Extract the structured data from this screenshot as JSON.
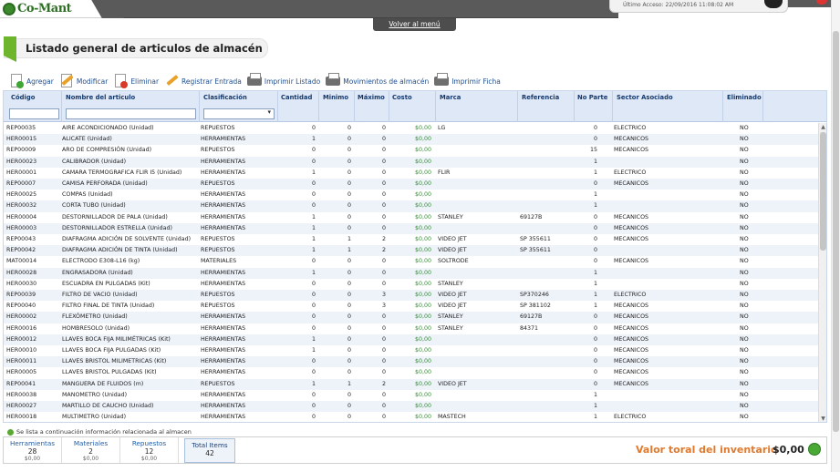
{
  "header": {
    "logo_text": "Co-Mant",
    "last_access": "Último Acceso: 22/09/2016 11:08:02 AM",
    "back_link": "Volver al menú"
  },
  "page": {
    "title": "Listado general de articulos de almacén"
  },
  "toolbar": {
    "add": "Agregar",
    "edit": "Modificar",
    "delete": "Eliminar",
    "register_entry": "Registrar Entrada",
    "print_list": "Imprimir Listado",
    "movements": "Movimientos de almacén",
    "print_sheet": "Imprimir Ficha"
  },
  "grid": {
    "columns": [
      "Código",
      "Nombre del articulo",
      "Clasificación",
      "Cantidad",
      "Minimo",
      "Máximo",
      "Costo",
      "Marca",
      "Referencia",
      "No Parte",
      "Sector Asociado",
      "Eliminado"
    ],
    "rows": [
      [
        "REP00035",
        "AIRE ACONDICIONADO (Unidad)",
        "REPUESTOS",
        "0",
        "0",
        "0",
        "$0,00",
        "LG",
        "",
        "0",
        "ELECTRICO",
        "NO"
      ],
      [
        "HER00015",
        "ALICATE (Unidad)",
        "HERRAMIENTAS",
        "1",
        "0",
        "0",
        "$0,00",
        "",
        "",
        "0",
        "MECANICOS",
        "NO"
      ],
      [
        "REP00009",
        "ARO DE COMPRESIÓN (Unidad)",
        "REPUESTOS",
        "0",
        "0",
        "0",
        "$0,00",
        "",
        "",
        "15",
        "MECANICOS",
        "NO"
      ],
      [
        "HER00023",
        "CALIBRADOR (Unidad)",
        "HERRAMIENTAS",
        "0",
        "0",
        "0",
        "$0,00",
        "",
        "",
        "1",
        "",
        "NO"
      ],
      [
        "HER00001",
        "CAMARA TERMOGRAFICA FLIR I5 (Unidad)",
        "HERRAMIENTAS",
        "1",
        "0",
        "0",
        "$0,00",
        "FLIR",
        "",
        "1",
        "ELECTRICO",
        "NO"
      ],
      [
        "REP00007",
        "CAMISA PERFORADA (Unidad)",
        "REPUESTOS",
        "0",
        "0",
        "0",
        "$0,00",
        "",
        "",
        "0",
        "MECANICOS",
        "NO"
      ],
      [
        "HER00025",
        "COMPAS (Unidad)",
        "HERRAMIENTAS",
        "0",
        "0",
        "0",
        "$0,00",
        "",
        "",
        "1",
        "",
        "NO"
      ],
      [
        "HER00032",
        "CORTA TUBO (Unidad)",
        "HERRAMIENTAS",
        "0",
        "0",
        "0",
        "$0,00",
        "",
        "",
        "1",
        "",
        "NO"
      ],
      [
        "HER00004",
        "DESTORNILLADOR DE PALA (Unidad)",
        "HERRAMIENTAS",
        "1",
        "0",
        "0",
        "$0,00",
        "STANLEY",
        "69127B",
        "0",
        "MECANICOS",
        "NO"
      ],
      [
        "HER00003",
        "DESTORNILLADOR ESTRELLA (Unidad)",
        "HERRAMIENTAS",
        "1",
        "0",
        "0",
        "$0,00",
        "",
        "",
        "0",
        "MECANICOS",
        "NO"
      ],
      [
        "REP00043",
        "DIAFRAGMA ADICIÓN DE SOLVENTE (Unidad)",
        "REPUESTOS",
        "1",
        "1",
        "2",
        "$0,00",
        "VIDEO JET",
        "SP 355611",
        "0",
        "MECANICOS",
        "NO"
      ],
      [
        "REP00042",
        "DIAFRAGMA ADICIÓN DE TINTA (Unidad)",
        "REPUESTOS",
        "1",
        "1",
        "2",
        "$0,00",
        "VIDEO JET",
        "SP 355611",
        "0",
        "",
        "NO"
      ],
      [
        "MAT00014",
        "ELECTRODO E308-L16 (kg)",
        "MATERIALES",
        "0",
        "0",
        "0",
        "$0,00",
        "SOLTRODE",
        "",
        "0",
        "MECANICOS",
        "NO"
      ],
      [
        "HER00028",
        "ENGRASADORA (Unidad)",
        "HERRAMIENTAS",
        "1",
        "0",
        "0",
        "$0,00",
        "",
        "",
        "1",
        "",
        "NO"
      ],
      [
        "HER00030",
        "ESCUADRA EN PULGADAS (Kit)",
        "HERRAMIENTAS",
        "0",
        "0",
        "0",
        "$0,00",
        "STANLEY",
        "",
        "1",
        "",
        "NO"
      ],
      [
        "REP00039",
        "FILTRO DE VACIO (Unidad)",
        "REPUESTOS",
        "0",
        "0",
        "3",
        "$0,00",
        "VIDEO JET",
        "SP370246",
        "1",
        "ELECTRICO",
        "NO"
      ],
      [
        "REP00040",
        "FILTRO FINAL DE TINTA (Unidad)",
        "REPUESTOS",
        "0",
        "0",
        "3",
        "$0,00",
        "VIDEO JET",
        "SP 381102",
        "1",
        "MECANICOS",
        "NO"
      ],
      [
        "HER00002",
        "FLEXÓMETRO (Unidad)",
        "HERRAMIENTAS",
        "0",
        "0",
        "0",
        "$0,00",
        "STANLEY",
        "69127B",
        "0",
        "MECANICOS",
        "NO"
      ],
      [
        "HER00016",
        "HOMBRESOLO (Unidad)",
        "HERRAMIENTAS",
        "0",
        "0",
        "0",
        "$0,00",
        "STANLEY",
        "84371",
        "0",
        "MECANICOS",
        "NO"
      ],
      [
        "HER00012",
        "LLAVES BOCA FIJA MILIMÉTRICAS (Kit)",
        "HERRAMIENTAS",
        "1",
        "0",
        "0",
        "$0,00",
        "",
        "",
        "0",
        "MECANICOS",
        "NO"
      ],
      [
        "HER00010",
        "LLAVES BOCA FIJA PULGADAS (Kit)",
        "HERRAMIENTAS",
        "1",
        "0",
        "0",
        "$0,00",
        "",
        "",
        "0",
        "MECANICOS",
        "NO"
      ],
      [
        "HER00011",
        "LLAVES BRISTOL MILIMETRICAS (Kit)",
        "HERRAMIENTAS",
        "0",
        "0",
        "0",
        "$0,00",
        "",
        "",
        "0",
        "MECANICOS",
        "NO"
      ],
      [
        "HER00005",
        "LLAVES BRISTOL PULGADAS (Kit)",
        "HERRAMIENTAS",
        "0",
        "0",
        "0",
        "$0,00",
        "",
        "",
        "0",
        "MECANICOS",
        "NO"
      ],
      [
        "REP00041",
        "MANGUERA DE FLUIDOS (m)",
        "REPUESTOS",
        "1",
        "1",
        "2",
        "$0,00",
        "VIDEO JET",
        "",
        "0",
        "MECANICOS",
        "NO"
      ],
      [
        "HER00038",
        "MANOMETRO (Unidad)",
        "HERRAMIENTAS",
        "0",
        "0",
        "0",
        "$0,00",
        "",
        "",
        "1",
        "",
        "NO"
      ],
      [
        "HER00027",
        "MARTILLO DE CAUCHO (Unidad)",
        "HERRAMIENTAS",
        "0",
        "0",
        "0",
        "$0,00",
        "",
        "",
        "1",
        "",
        "NO"
      ],
      [
        "HER00018",
        "MULTIMETRO (Unidad)",
        "HERRAMIENTAS",
        "0",
        "0",
        "0",
        "$0,00",
        "MASTECH",
        "",
        "1",
        "ELECTRICO",
        "NO"
      ]
    ]
  },
  "footer": {
    "info": "Se lista a continuación información relacionada al almacen",
    "summary": [
      {
        "label": "Herramientas",
        "count": "28",
        "money": "$0,00"
      },
      {
        "label": "Materiales",
        "count": "2",
        "money": "$0,00"
      },
      {
        "label": "Repuestos",
        "count": "12",
        "money": "$0,00"
      }
    ],
    "total_label": "Total Items",
    "total_count": "42",
    "inventory_label": "Valor toral del inventario",
    "inventory_value": "$0,00"
  },
  "colors": {
    "accent_green": "#6cb52d",
    "header_blue": "#dfe8f6",
    "link_blue": "#1f4d8f",
    "inventory_orange": "#e07a2e"
  }
}
